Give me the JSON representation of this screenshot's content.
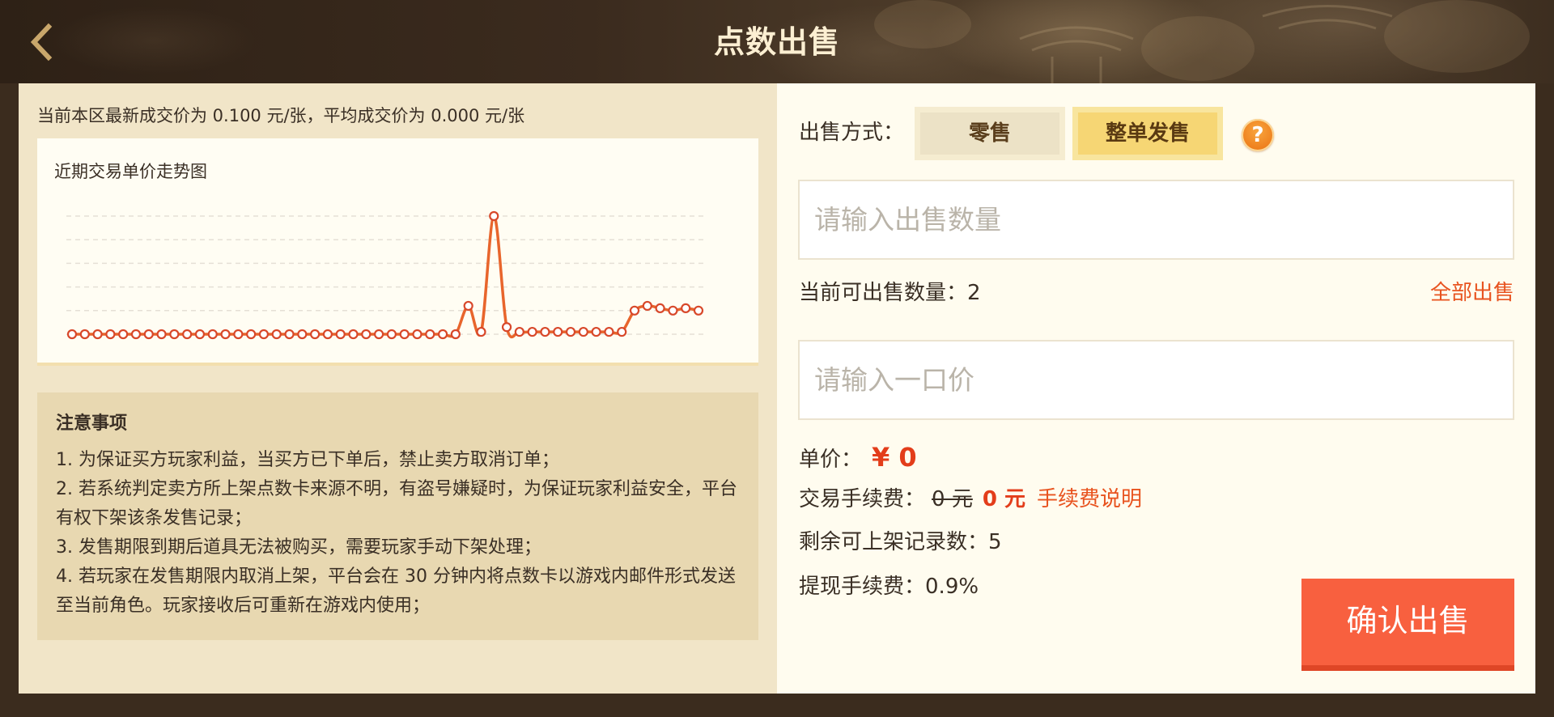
{
  "header": {
    "title": "点数出售",
    "back_icon": "chevron-left-icon"
  },
  "market": {
    "summary": "当前本区最新成交价为 0.100 元/张，平均成交价为 0.000 元/张"
  },
  "chart_data": {
    "type": "line",
    "title": "近期交易单价走势图",
    "values": [
      0,
      0,
      0,
      0,
      0,
      0,
      0,
      0,
      0,
      0,
      0,
      0,
      0,
      0,
      0,
      0,
      0,
      0,
      0,
      0,
      0,
      0,
      0,
      0,
      0,
      0,
      0,
      0,
      0,
      0,
      0,
      0.12,
      0.01,
      0.5,
      0.03,
      0.01,
      0.01,
      0.01,
      0.01,
      0.01,
      0.01,
      0.01,
      0.01,
      0.01,
      0.1,
      0.12,
      0.11,
      0.1,
      0.11,
      0.1
    ],
    "ylim": [
      0,
      0.5
    ],
    "grid": true,
    "markers": true
  },
  "notice": {
    "title": "注意事项",
    "items": [
      "1. 为保证买方玩家利益，当买方已下单后，禁止卖方取消订单；",
      "2. 若系统判定卖方所上架点数卡来源不明，有盗号嫌疑时，为保证玩家利益安全，平台有权下架该条发售记录；",
      "3. 发售期限到期后道具无法被购买，需要玩家手动下架处理；",
      "4. 若玩家在发售期限内取消上架，平台会在 30 分钟内将点数卡以游戏内邮件形式发送至当前角色。玩家接收后可重新在游戏内使用；"
    ]
  },
  "sell_form": {
    "method_label": "出售方式：",
    "methods": [
      {
        "label": "零售",
        "selected": false
      },
      {
        "label": "整单发售",
        "selected": true
      }
    ],
    "help_icon": "question-mark-icon",
    "quantity_placeholder": "请输入出售数量",
    "available": {
      "label": "当前可出售数量：",
      "value": "2"
    },
    "sell_all_label": "全部出售",
    "price_placeholder": "请输入一口价",
    "unit_price": {
      "label": "单价：",
      "value": "¥ 0"
    },
    "fee": {
      "label": "交易手续费：",
      "original": "0 元",
      "current": "0 元",
      "link": "手续费说明"
    },
    "remaining_listings": {
      "label": "剩余可上架记录数：",
      "value": "5"
    },
    "withdraw_fee": {
      "label": "提现手续费：",
      "value": "0.9%"
    },
    "confirm_label": "确认出售"
  },
  "colors": {
    "frame": "#3b2c1e",
    "left_panel": "#f1e5c8",
    "right_panel": "#fffcef",
    "notice_box": "#e8d8b1",
    "selected_method": "#f6d674",
    "price_red": "#e33d1a",
    "link_orange": "#e8531f",
    "confirm_button": "#f8603f",
    "chart_line": "#e8652c",
    "chart_marker": "#d8482a"
  }
}
